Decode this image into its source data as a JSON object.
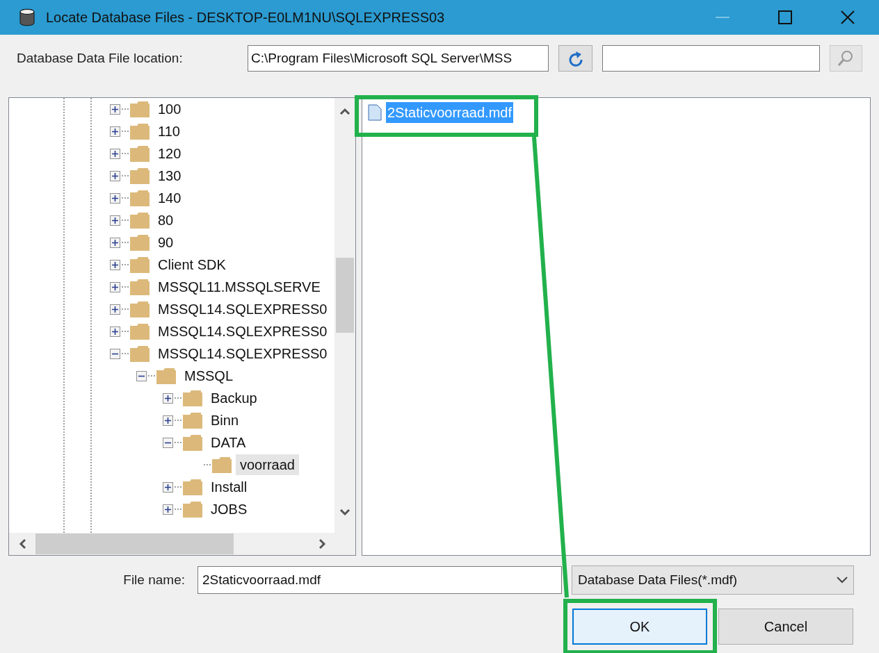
{
  "window": {
    "title": "Locate Database Files - DESKTOP-E0LM1NU\\SQLEXPRESS03"
  },
  "location": {
    "label": "Database Data File location:",
    "value": "C:\\Program Files\\Microsoft SQL Server\\MSS"
  },
  "tree": [
    {
      "label": "100",
      "expanded": false,
      "selected": false
    },
    {
      "label": "110",
      "expanded": false,
      "selected": false
    },
    {
      "label": "120",
      "expanded": false,
      "selected": false
    },
    {
      "label": "130",
      "expanded": false,
      "selected": false
    },
    {
      "label": "140",
      "expanded": false,
      "selected": false
    },
    {
      "label": "80",
      "expanded": false,
      "selected": false
    },
    {
      "label": "90",
      "expanded": false,
      "selected": false
    },
    {
      "label": "Client SDK",
      "expanded": false,
      "selected": false
    },
    {
      "label": "MSSQL11.MSSQLSERVE",
      "expanded": false,
      "selected": false
    },
    {
      "label": "MSSQL14.SQLEXPRESS0",
      "expanded": false,
      "selected": false
    },
    {
      "label": "MSSQL14.SQLEXPRESS0",
      "expanded": false,
      "selected": false
    },
    {
      "label": "MSSQL14.SQLEXPRESS0",
      "expanded": true,
      "selected": false,
      "children": [
        {
          "label": "MSSQL",
          "expanded": true,
          "selected": false,
          "children": [
            {
              "label": "Backup",
              "expanded": false,
              "selected": false
            },
            {
              "label": "Binn",
              "expanded": false,
              "selected": false
            },
            {
              "label": "DATA",
              "expanded": true,
              "selected": false,
              "children": [
                {
                  "label": "voorraad",
                  "selected": true
                }
              ]
            },
            {
              "label": "Install",
              "expanded": false,
              "selected": false
            },
            {
              "label": "JOBS",
              "expanded": false,
              "selected": false
            }
          ]
        }
      ]
    }
  ],
  "files": [
    {
      "name": "2Staticvoorraad.mdf",
      "selected": true
    }
  ],
  "file_name": {
    "label": "File name:",
    "value": "2Staticvoorraad.mdf"
  },
  "file_type": {
    "value": "Database Data Files(*.mdf)"
  },
  "buttons": [
    {
      "label": "OK",
      "kind": "default"
    },
    {
      "label": "Cancel",
      "kind": "normal"
    }
  ]
}
